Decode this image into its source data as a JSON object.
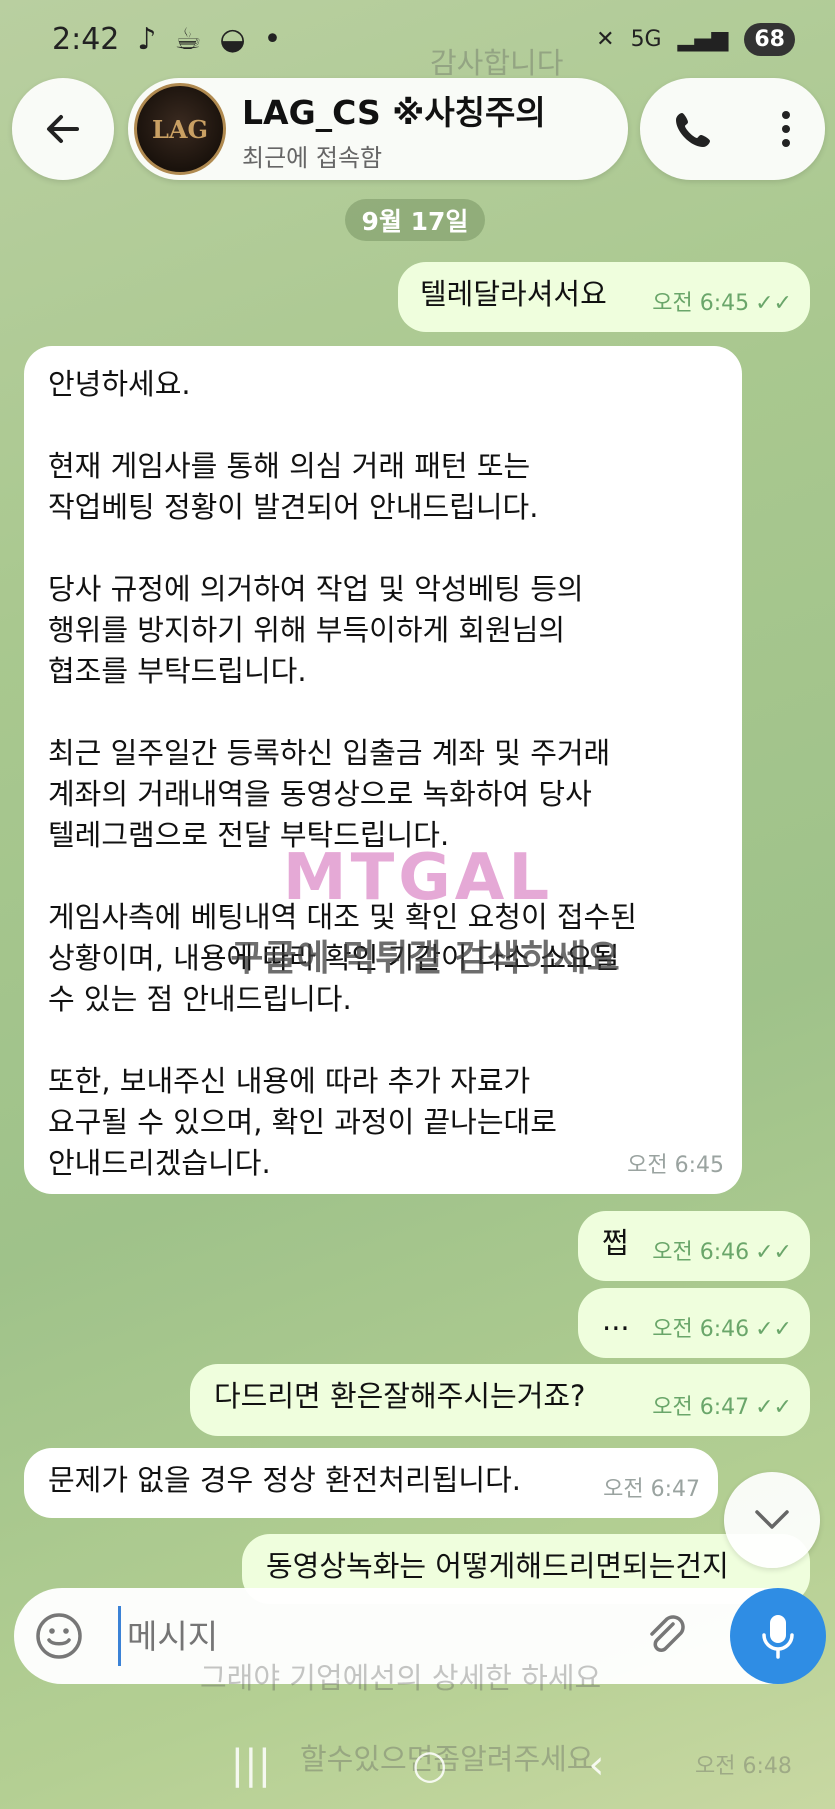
{
  "status_bar": {
    "time": "2:42",
    "notif_icons": [
      "bell-icon",
      "coffee-icon",
      "bowl-icon",
      "dot-icon"
    ],
    "network": "5G",
    "battery": "68"
  },
  "header": {
    "avatar_text": "LAG",
    "chat_name": "LAG_CS ※사칭주의",
    "chat_status": "최근에 접속함",
    "faded_top_message": "감사합니다"
  },
  "date_separator": "9월 17일",
  "messages": [
    {
      "dir": "out",
      "text": "텔레달라셔서요",
      "time": "오전 6:45",
      "read": true
    },
    {
      "dir": "in",
      "text": "안녕하세요.\n\n현재 게임사를 통해 의심 거래 패턴 또는\n작업베팅 정황이 발견되어 안내드립니다.\n\n당사 규정에 의거하여 작업 및 악성베팅 등의\n행위를 방지하기 위해 부득이하게 회원님의\n협조를 부탁드립니다.\n\n최근 일주일간 등록하신 입출금 계좌 및 주거래\n계좌의 거래내역을 동영상으로 녹화하여 당사\n텔레그램으로 전달 부탁드립니다.\n\n게임사측에 베팅내역 대조 및 확인 요청이 접수된\n상황이며, 내용에 따라 확인 기간이 다소 소요될\n수 있는 점 안내드립니다.\n\n또한, 보내주신 내용에 따라 추가 자료가\n요구될 수 있으며, 확인 과정이 끝나는대로\n안내드리겠습니다.",
      "time": "오전 6:45"
    },
    {
      "dir": "out",
      "text": "쩝",
      "time": "오전 6:46",
      "read": true
    },
    {
      "dir": "out",
      "text": "...",
      "time": "오전 6:46",
      "read": true
    },
    {
      "dir": "out",
      "text": "다드리면 환은잘해주시는거죠?",
      "time": "오전 6:47",
      "read": true
    },
    {
      "dir": "in",
      "text": "문제가 없을 경우 정상 환전처리됩니다.",
      "time": "오전 6:47"
    },
    {
      "dir": "out",
      "text": "동영상녹화는 어떻게해드리면되는건지",
      "time": "",
      "read": false
    }
  ],
  "watermark": {
    "logo": "MTGAL",
    "text": "구글에 먹튀갤 검색하세요"
  },
  "composer": {
    "placeholder": "메시지"
  },
  "below_composer": {
    "line1": "그래야 기업에선의 상세한 하세요",
    "line2": "할수있으면좀알려주세요",
    "line2_time": "오전 6:48"
  },
  "colors": {
    "outgoing_bubble": "#effedd",
    "incoming_bubble": "#ffffff",
    "accent": "#2f8de4",
    "read_check": "#6aa66a"
  }
}
